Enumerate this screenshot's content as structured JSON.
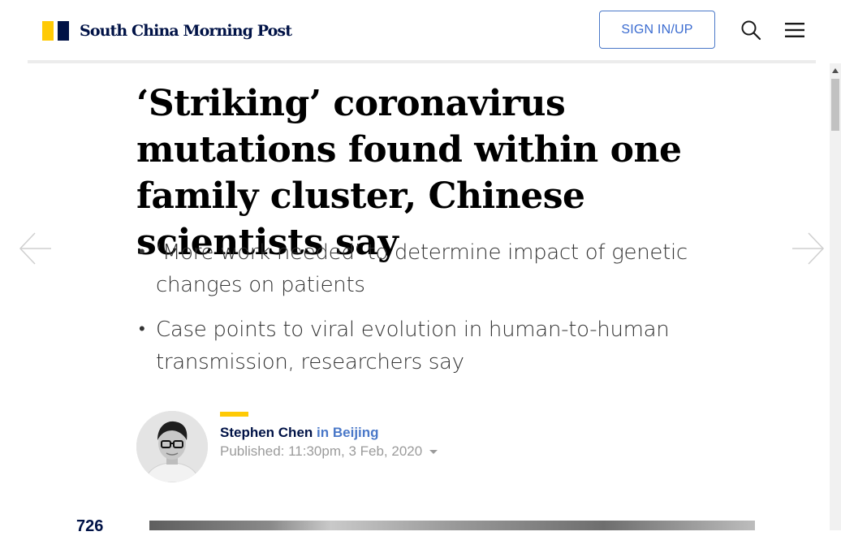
{
  "header": {
    "brand": "South China Morning Post",
    "signin_label": "SIGN IN/UP",
    "icons": [
      "search-icon",
      "menu-icon"
    ],
    "brand_colors": {
      "yellow": "#FFCA05",
      "navy": "#001246"
    }
  },
  "article": {
    "headline": "‘Striking’ coronavirus mutations found within one family cluster, Chinese scientists say",
    "summary": [
      "‘More work needed’ to determine impact of genetic changes on patients",
      "Case points to viral evolution in human-to-human transmission, researchers say"
    ],
    "author": {
      "name": "Stephen Chen",
      "location": "in Beijing",
      "published": "Published: 11:30pm, 3 Feb, 2020"
    },
    "comment_count": "726"
  },
  "nav": {
    "prev_icon": "arrow-left-icon",
    "next_icon": "arrow-right-icon"
  },
  "colors": {
    "accent_blue": "#4a78c8",
    "meta_grey": "#9b9b9b"
  }
}
